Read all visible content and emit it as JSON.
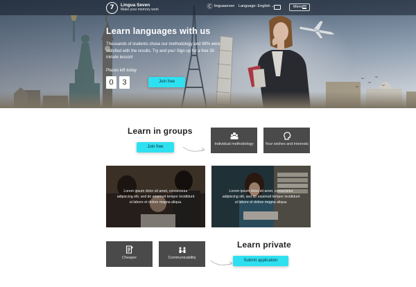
{
  "header": {
    "brand_name": "Lingua Seven",
    "brand_tagline": "Make your memory work",
    "username": "linguaseven",
    "language_label": "Language: English",
    "menu_label": "Menu"
  },
  "hero": {
    "title": "Learn languages with us",
    "subtitle": "Thousands of students chose our methodology and 98% were satisfied with the results. Try and you! Sign up for a free 30 minute lesson!",
    "places_label": "Places left today",
    "places_digits": [
      "0",
      "3"
    ],
    "cta": "Join free"
  },
  "groups": {
    "title": "Learn in groups",
    "cta": "Join free",
    "features": [
      {
        "label": "Individual methodology",
        "icon": "group-icon"
      },
      {
        "label": "Your wishes and interests",
        "icon": "head-icon"
      }
    ],
    "photos": [
      {
        "text": "Lorem ipsum dolor sit amet, consectetur adipiscing elit, sed do eiusmod tempor incididunt ut labore et dolore magna aliqua."
      },
      {
        "text": "Lorem ipsum dolor sit amet, consectetur adipiscing elit, sed do eiusmod tempor incididunt ut labore et dolore magna aliqua."
      }
    ]
  },
  "private": {
    "title": "Learn private",
    "cta": "Submit application",
    "features": [
      {
        "label": "Cheaper",
        "icon": "document-icon"
      },
      {
        "label": "Communicability",
        "icon": "conversation-icon"
      }
    ]
  },
  "colors": {
    "accent": "#2fe0f0",
    "tile": "#4a4a4a"
  }
}
